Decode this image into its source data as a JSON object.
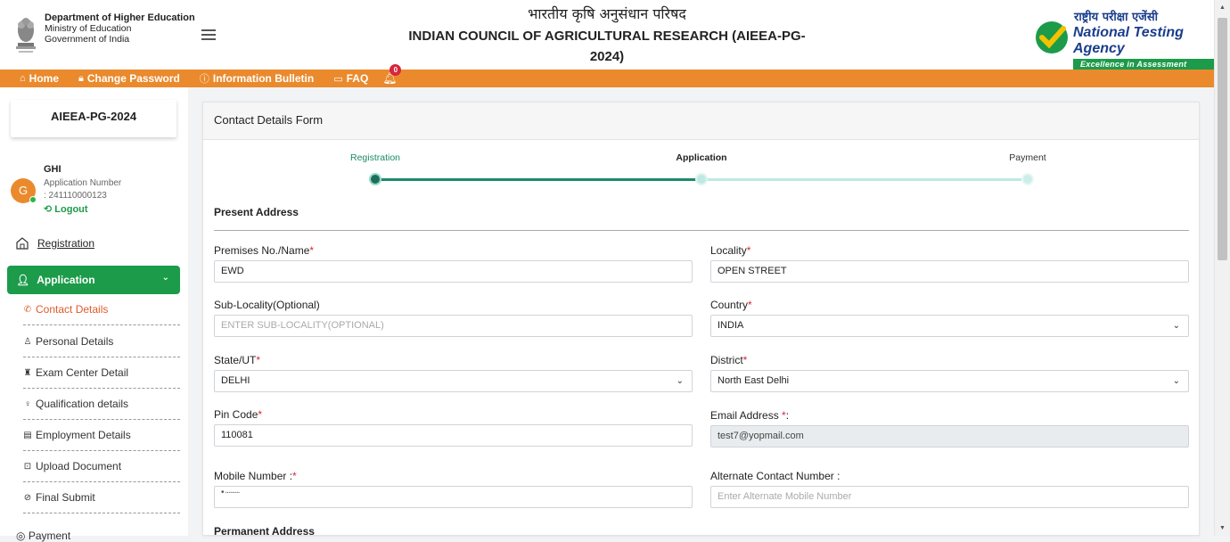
{
  "header": {
    "gov_line1": "Department of Higher Education",
    "gov_line2": "Ministry of Education",
    "gov_line3": "Government of India",
    "title_hindi": "भारतीय कृषि अनुसंधान परिषद",
    "title_english": "INDIAN COUNCIL OF AGRICULTURAL RESEARCH (AIEEA-PG-2024)",
    "nta_hindi": "राष्ट्रीय परीक्षा एजेंसी",
    "nta_english": "National Testing Agency",
    "nta_tagline": "Excellence in Assessment"
  },
  "navbar": {
    "home": "Home",
    "change_password": "Change Password",
    "info_bulletin": "Information Bulletin",
    "faq": "FAQ",
    "notification_count": "0"
  },
  "sidebar": {
    "exam_name": "AIEEA-PG-2024",
    "user_initial": "G",
    "user_name": "GHI",
    "app_number_label": "Application Number",
    "app_number_value": ": 241110000123",
    "logout": "Logout",
    "registration": "Registration",
    "application": "Application",
    "sub_items": [
      {
        "label": "Contact Details",
        "icon": "phone-icon"
      },
      {
        "label": "Personal Details",
        "icon": "user-icon"
      },
      {
        "label": "Exam Center Detail",
        "icon": "center-icon"
      },
      {
        "label": "Qualification details",
        "icon": "award-icon"
      },
      {
        "label": "Employment Details",
        "icon": "briefcase-icon"
      },
      {
        "label": "Upload Document",
        "icon": "upload-icon"
      },
      {
        "label": "Final Submit",
        "icon": "check-circle-icon"
      }
    ],
    "more_item": "Payment"
  },
  "form": {
    "title": "Contact Details Form",
    "steps": [
      "Registration",
      "Application",
      "Payment"
    ],
    "present_address_title": "Present Address",
    "permanent_address_title": "Permanent Address",
    "premises_label": "Premises No./Name",
    "premises_value": "EWD",
    "locality_label": "Locality",
    "locality_value": "OPEN STREET",
    "sublocality_label": "Sub-Locality(Optional)",
    "sublocality_placeholder": "ENTER SUB-LOCALITY(OPTIONAL)",
    "country_label": "Country",
    "country_value": "INDIA",
    "state_label": "State/UT",
    "state_value": "DELHI",
    "district_label": "District",
    "district_value": "North East Delhi",
    "pincode_label": "Pin Code",
    "pincode_value": "110081",
    "email_label": "Email Address ",
    "email_value": "test7@yopmail.com",
    "mobile_label": "Mobile Number :",
    "alt_mobile_label": "Alternate Contact Number :",
    "alt_mobile_placeholder": "Enter Alternate Mobile Number"
  },
  "colors": {
    "accent_orange": "#ea8a2d",
    "accent_green": "#1c9b4a",
    "step_done": "#1c8a6a",
    "step_pending": "#bfe9e2",
    "required": "#d7263d"
  }
}
